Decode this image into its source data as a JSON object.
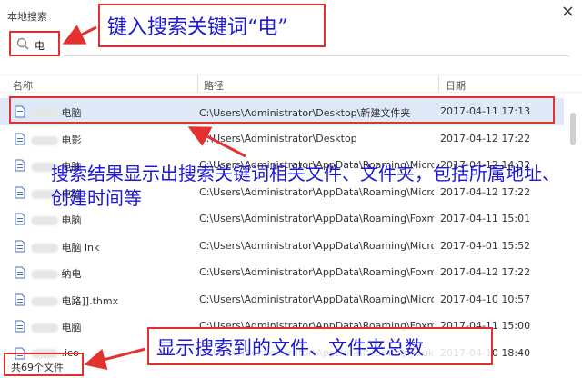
{
  "window": {
    "title": "本地搜索",
    "close_glyph": "×"
  },
  "search": {
    "query": "电"
  },
  "columns": {
    "name": "名称",
    "path": "路径",
    "date": "日期"
  },
  "rows": [
    {
      "name": "电脑",
      "path": "C:\\Users\\Administrator\\Desktop\\新建文件夹",
      "date": "2017-04-11 17:13",
      "selected": true
    },
    {
      "name": "电影",
      "path": "C:\\Users\\Administrator\\Desktop",
      "date": "2017-04-12 17:22"
    },
    {
      "name": "电脑",
      "path": "C:\\Users\\Administrator\\AppData\\Roaming\\Micro...",
      "date": "2017-04-12 14:32"
    },
    {
      "name": "电脑",
      "path": "C:\\Users\\Administrator\\AppData\\Roaming\\Micro...",
      "date": "2017-04-12 17:22"
    },
    {
      "name": "电脑",
      "path": "C:\\Users\\Administrator\\AppData\\Roaming\\Foxm...",
      "date": "2017-04-11 15:01"
    },
    {
      "name": "电脑      lnk",
      "path": "C:\\Users\\Administrator\\AppData\\Roaming\\Micro...",
      "date": "2017-04-01 15:52"
    },
    {
      "name": "纳电",
      "path": "C:\\Users\\Administrator\\AppData\\Roaming\\Foxm...",
      "date": "2017-04-12 17:22"
    },
    {
      "name": "电路]].thmx",
      "path": "C:\\Users\\Administrator\\AppData\\Roaming\\Micro...",
      "date": "2017-04-10 10:57"
    },
    {
      "name": "电脑",
      "path": "C:\\Users\\Administrator\\AppData\\Roaming\\Foxm...",
      "date": "2017-04-11 15:00"
    },
    {
      "name": ".ico",
      "path": "C:\\Users\\Administrator\\AppData\\Roaming\\youku...",
      "date": "2017-04-10 18:40"
    }
  ],
  "status": {
    "count_text": "共69个文件"
  },
  "annotations": {
    "search_note": "键入搜索关键词“电”",
    "result_note": "搜索结果显示出搜索关键词相关文件、文件夹，包括所属地址、创建时间等",
    "count_note": "显示搜索到的文件、文件夹总数"
  },
  "colors": {
    "annotation_text": "#1b18d6",
    "annotation_box": "#e53030",
    "selected_row": "#dfe8f7"
  }
}
